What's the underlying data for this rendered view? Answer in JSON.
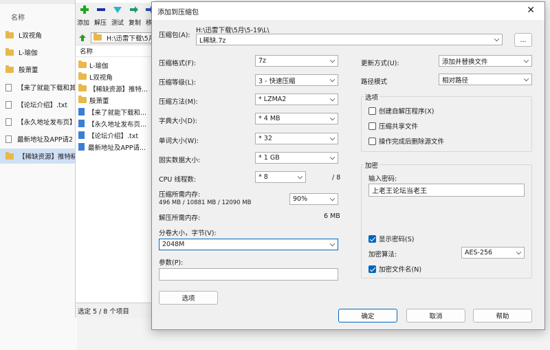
{
  "explorer": {
    "header": "名称",
    "items": [
      {
        "label": "L双视角",
        "icon": "folder-icon"
      },
      {
        "label": "L-瑜伽",
        "icon": "folder-icon"
      },
      {
        "label": "殷萧董",
        "icon": "folder-icon"
      },
      {
        "label": "【来了就能下载和其",
        "icon": "text-file-icon"
      },
      {
        "label": "【论坛介绍】.txt",
        "icon": "text-file-icon"
      },
      {
        "label": "【永久地址发布页】",
        "icon": "text-file-icon"
      },
      {
        "label": "最新地址及APP请2",
        "icon": "text-file-icon"
      },
      {
        "label": "【稀缺资源】推特精",
        "icon": "folder-icon"
      }
    ]
  },
  "sevenzip": {
    "toolbar": {
      "add": "添加",
      "extract": "解压",
      "test": "测试",
      "copy": "复制",
      "move": "移"
    },
    "path": "H:\\迅雷下载\\5月",
    "column_name": "名称",
    "items": [
      {
        "label": "L-瑜伽",
        "icon": "folder-icon"
      },
      {
        "label": "L双视角",
        "icon": "folder-icon"
      },
      {
        "label": "【稀缺资源】推特...",
        "icon": "folder-icon"
      },
      {
        "label": "殷萧董",
        "icon": "folder-icon"
      },
      {
        "label": "【来了就能下载和...",
        "icon": "doc-icon"
      },
      {
        "label": "【永久地址发布页...",
        "icon": "doc-icon"
      },
      {
        "label": "【论坛介绍】.txt",
        "icon": "doc-icon"
      },
      {
        "label": "最新地址及APP请...",
        "icon": "doc-icon"
      }
    ],
    "status": "选定 5 / 8 个项目"
  },
  "dialog": {
    "title": "添加到压缩包",
    "archive_label": "压缩包(A):",
    "archive_path": "H:\\迅雷下载\\5月\\5-19\\L\\",
    "archive_name": "L稀缺.7z",
    "browse": "...",
    "format_label": "压缩格式(F):",
    "format_value": "7z",
    "level_label": "压缩等级(L):",
    "level_value": "3 - 快速压缩",
    "method_label": "压缩方法(M):",
    "method_value": "* LZMA2",
    "dict_label": "字典大小(D):",
    "dict_value": "* 4 MB",
    "word_label": "单词大小(W):",
    "word_value": "* 32",
    "solid_label": "固实数据大小:",
    "solid_value": "* 1 GB",
    "cpu_label": "CPU 线程数:",
    "cpu_value": "* 8",
    "cpu_total": "/ 8",
    "mem_label": "压缩所需内存:",
    "mem_detail": "496 MB / 10881 MB / 12090 MB",
    "mem_percent": "90%",
    "decomp_label": "解压所需内存:",
    "decomp_value": "6 MB",
    "split_label": "分卷大小，字节(V):",
    "split_value": "2048M",
    "params_label": "参数(P):",
    "params_value": "",
    "options_button": "选项",
    "update_label": "更新方式(U):",
    "update_value": "添加并替换文件",
    "pathmode_label": "路径模式",
    "pathmode_value": "相对路径",
    "options_group": "选项",
    "opt_sfx": "创建自解压程序(X)",
    "opt_shared": "压缩共享文件",
    "opt_delete": "操作完成后删除源文件",
    "encrypt_group": "加密",
    "password_label": "输入密码:",
    "password_value": "上老王论坛当老王",
    "show_password": "显示密码(S)",
    "enc_method_label": "加密算法:",
    "enc_method_value": "AES-256",
    "enc_names": "加密文件名(N)",
    "ok": "确定",
    "cancel": "取消",
    "help": "帮助"
  }
}
